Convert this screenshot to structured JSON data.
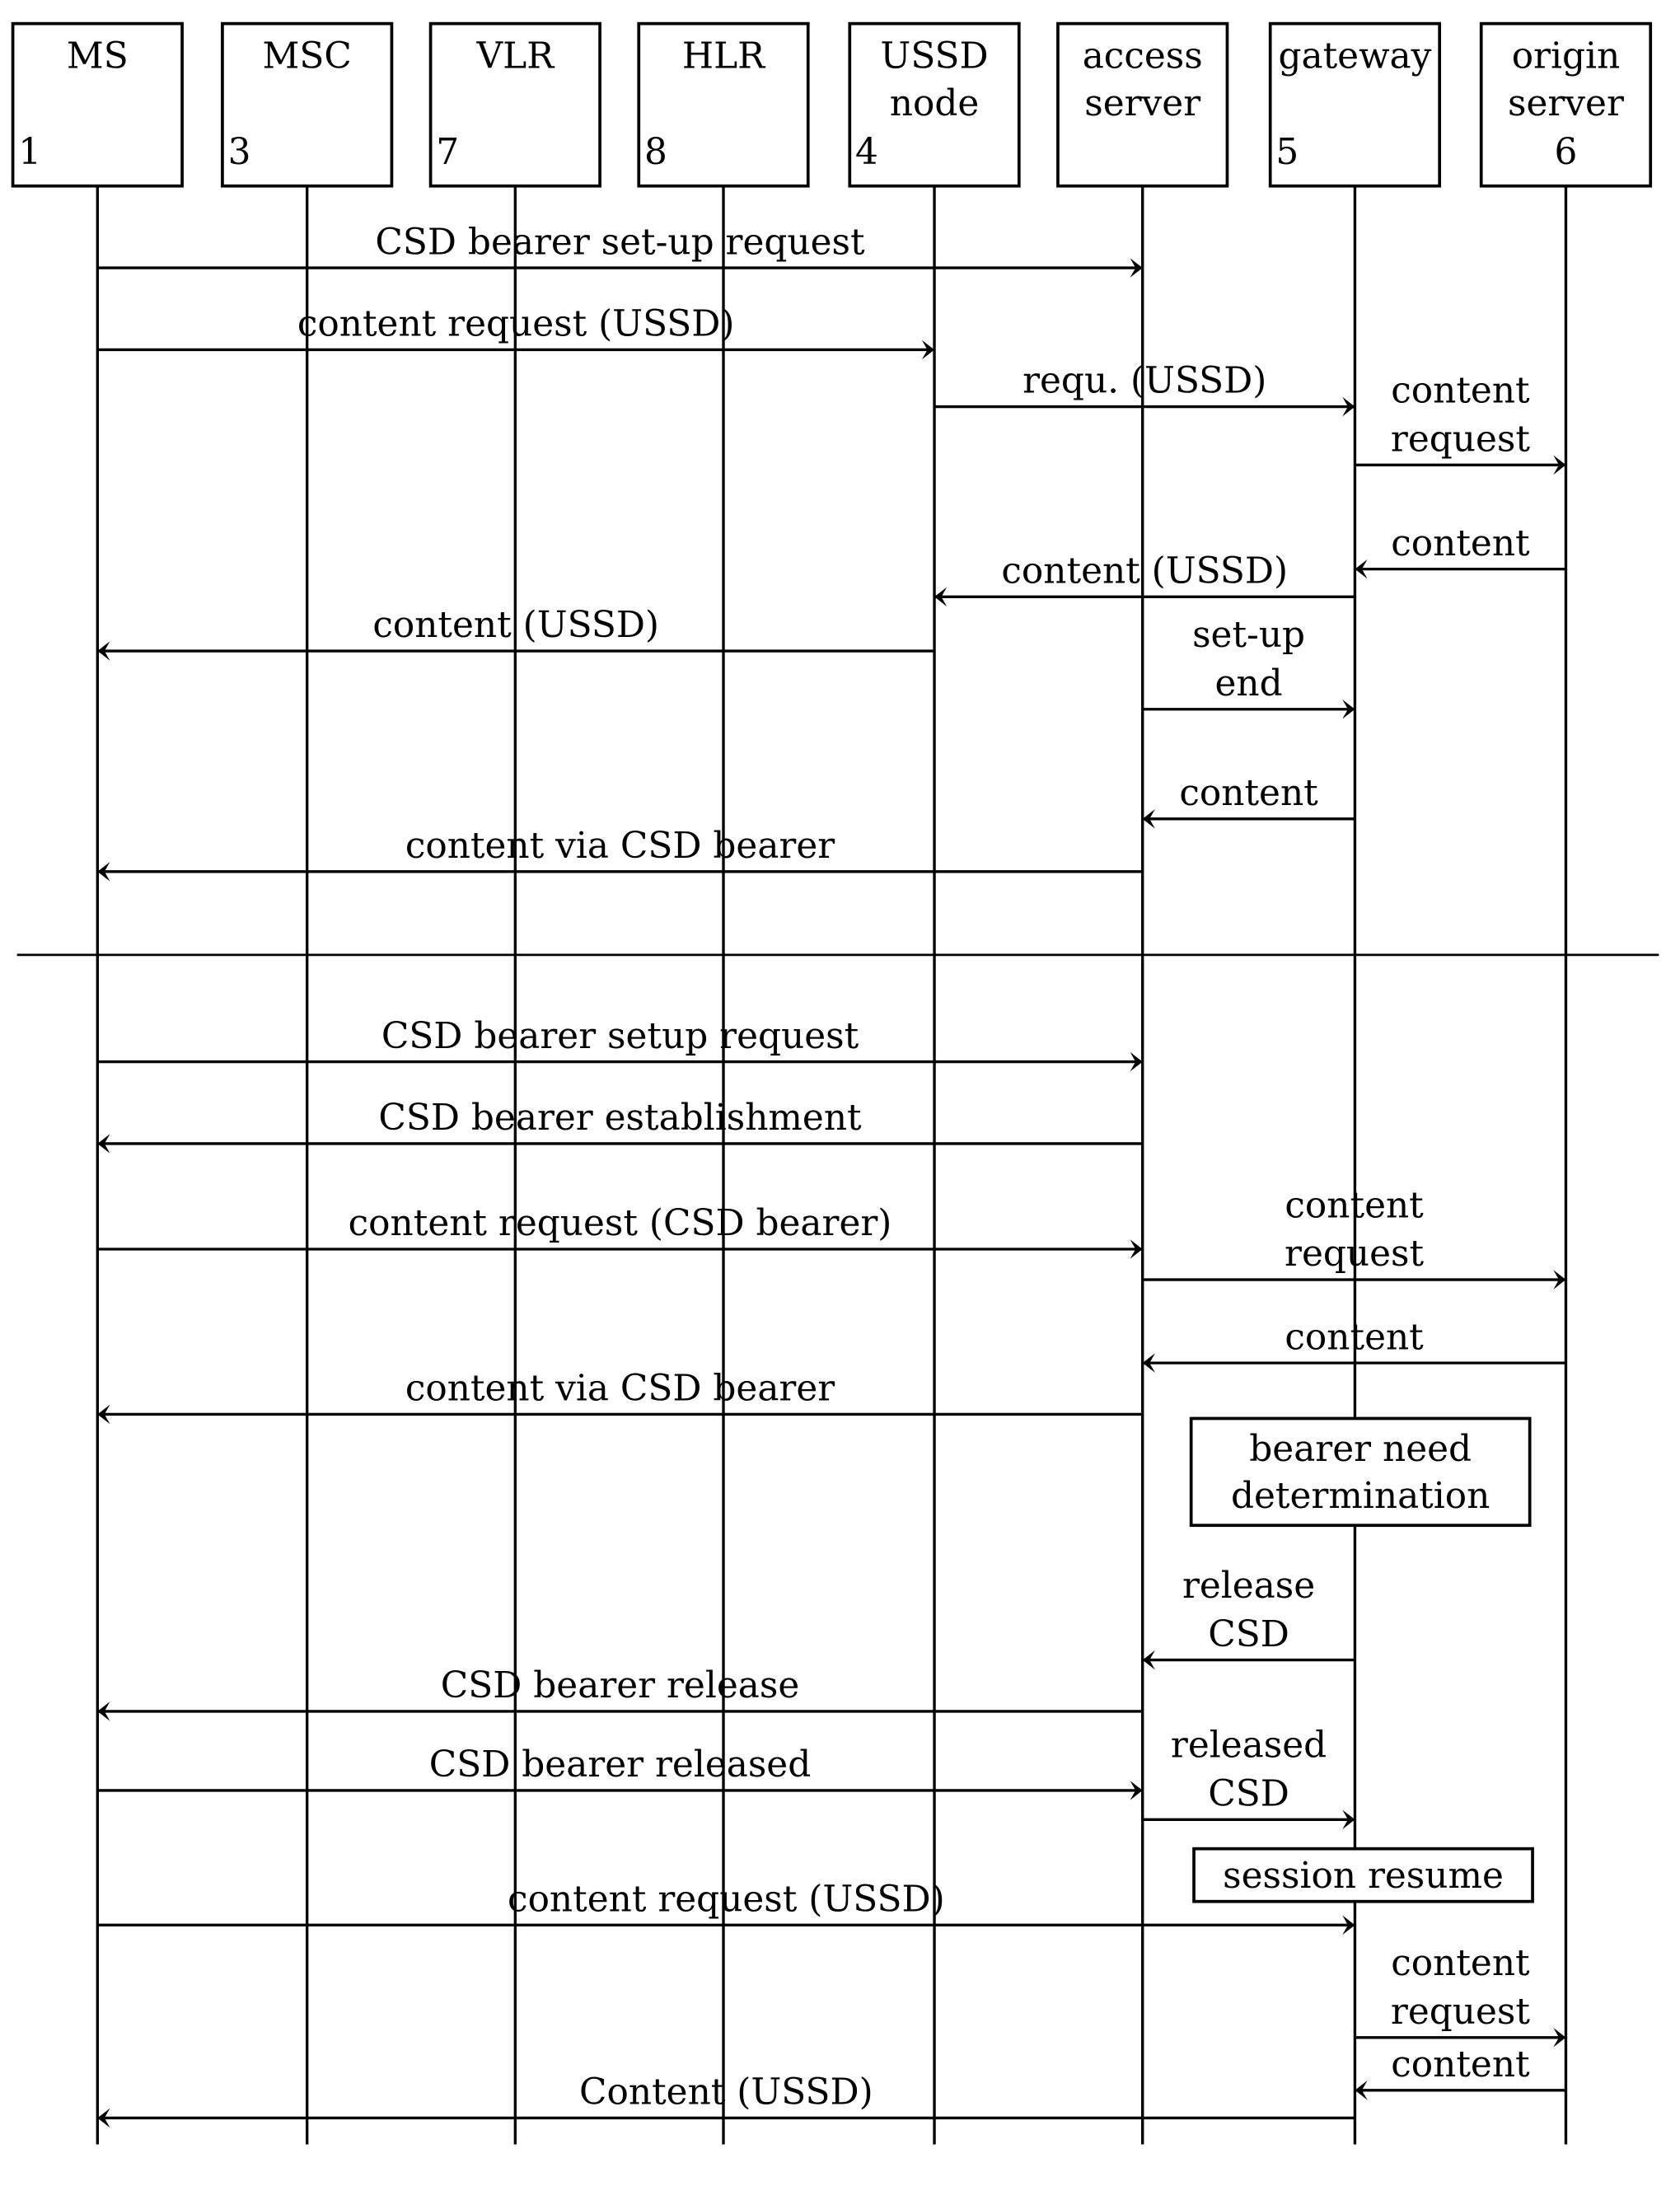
{
  "participants": [
    {
      "id": "ms",
      "lines": [
        "MS"
      ],
      "number": "1",
      "numPos": "left"
    },
    {
      "id": "msc",
      "lines": [
        "MSC"
      ],
      "number": "3",
      "numPos": "left"
    },
    {
      "id": "vlr",
      "lines": [
        "VLR"
      ],
      "number": "7",
      "numPos": "left"
    },
    {
      "id": "hlr",
      "lines": [
        "HLR"
      ],
      "number": "8",
      "numPos": "left"
    },
    {
      "id": "ussd",
      "lines": [
        "USSD",
        "node"
      ],
      "number": "4",
      "numPos": "left"
    },
    {
      "id": "access",
      "lines": [
        "access",
        "server"
      ],
      "number": "",
      "numPos": "left"
    },
    {
      "id": "gateway",
      "lines": [
        "gateway"
      ],
      "number": "5",
      "numPos": "left"
    },
    {
      "id": "origin",
      "lines": [
        "origin",
        "server"
      ],
      "number": "6",
      "numPos": "center"
    }
  ],
  "section1": [
    {
      "from": "ms",
      "to": "access",
      "lines": [
        "CSD bearer set-up request"
      ]
    },
    {
      "from": "ms",
      "to": "ussd",
      "lines": [
        "content request (USSD)"
      ]
    },
    {
      "from": "ussd",
      "to": "gateway",
      "lines": [
        "requ. (USSD)"
      ]
    },
    {
      "from": "gateway",
      "to": "origin",
      "lines": [
        "content",
        "request"
      ]
    },
    {
      "from": "origin",
      "to": "gateway",
      "lines": [
        "content"
      ]
    },
    {
      "from": "gateway",
      "to": "ussd",
      "lines": [
        "content (USSD)"
      ]
    },
    {
      "from": "ussd",
      "to": "ms",
      "lines": [
        "content (USSD)"
      ]
    },
    {
      "from": "access",
      "to": "gateway",
      "lines": [
        "set-up",
        "end"
      ]
    },
    {
      "from": "gateway",
      "to": "access",
      "lines": [
        "content"
      ]
    },
    {
      "from": "access",
      "to": "ms",
      "lines": [
        "content via CSD bearer"
      ]
    }
  ],
  "section2": [
    {
      "from": "ms",
      "to": "access",
      "lines": [
        "CSD bearer setup request"
      ]
    },
    {
      "from": "access",
      "to": "ms",
      "lines": [
        "CSD bearer establishment"
      ]
    },
    {
      "from": "ms",
      "to": "access",
      "lines": [
        "content request (CSD bearer)"
      ]
    },
    {
      "from": "access",
      "to": "origin",
      "lines": [
        "content",
        "request"
      ]
    },
    {
      "from": "origin",
      "to": "access",
      "lines": [
        "content"
      ]
    },
    {
      "from": "access",
      "to": "ms",
      "lines": [
        "content via CSD bearer"
      ]
    },
    {
      "note": "gateway",
      "lines": [
        "bearer need",
        "determination"
      ]
    },
    {
      "from": "gateway",
      "to": "access",
      "lines": [
        "release",
        "CSD"
      ]
    },
    {
      "from": "access",
      "to": "ms",
      "lines": [
        "CSD bearer release"
      ]
    },
    {
      "from": "ms",
      "to": "access",
      "lines": [
        "CSD bearer released"
      ]
    },
    {
      "from": "access",
      "to": "gateway",
      "lines": [
        "released",
        "CSD"
      ]
    },
    {
      "note": "gateway",
      "lines": [
        "session resume"
      ]
    },
    {
      "from": "ms",
      "to": "gateway",
      "lines": [
        "content request (USSD)"
      ]
    },
    {
      "from": "gateway",
      "to": "origin",
      "lines": [
        "content",
        "request"
      ]
    },
    {
      "from": "origin",
      "to": "gateway",
      "lines": [
        "content"
      ]
    },
    {
      "from": "gateway",
      "to": "ms",
      "lines": [
        "Content (USSD)"
      ]
    }
  ]
}
